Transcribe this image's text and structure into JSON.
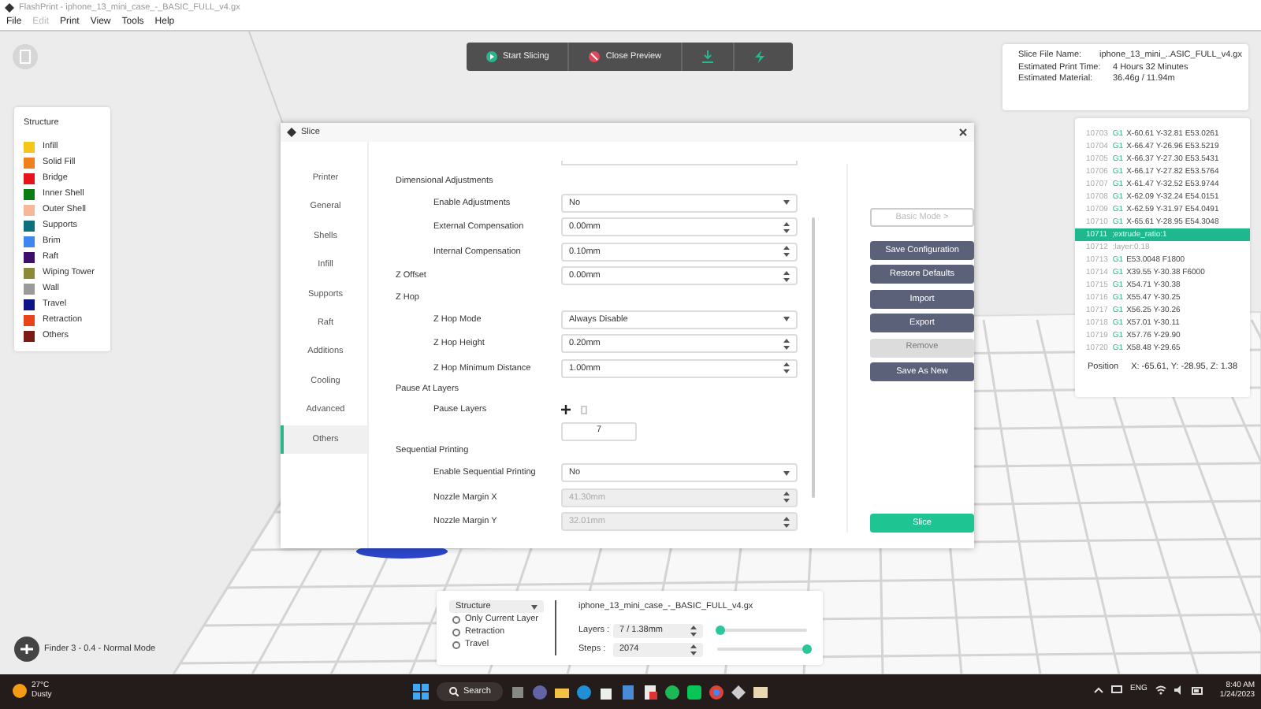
{
  "window": {
    "title": "FlashPrint - iphone_13_mini_case_-_BASIC_FULL_v4.gx"
  },
  "menu": [
    {
      "label": "File",
      "disabled": false
    },
    {
      "label": "Edit",
      "disabled": true
    },
    {
      "label": "Print",
      "disabled": false
    },
    {
      "label": "View",
      "disabled": false
    },
    {
      "label": "Tools",
      "disabled": false
    },
    {
      "label": "Help",
      "disabled": false
    }
  ],
  "toolbar": [
    {
      "kind": "start",
      "label": "Start Slicing"
    },
    {
      "kind": "close",
      "label": "Close Preview"
    },
    {
      "kind": "export"
    },
    {
      "kind": "send"
    }
  ],
  "slice_info": [
    {
      "label": "Slice File Name:",
      "value": "iphone_13_mini_..ASIC_FULL_v4.gx"
    },
    {
      "label": "Estimated Print Time:",
      "value": "4 Hours 32 Minutes"
    },
    {
      "label": "Estimated Material:",
      "value": "36.46g / 11.94m"
    }
  ],
  "gcode": {
    "lines": [
      {
        "number": "10703",
        "command": "G1",
        "args": "X-60.61 Y-32.81 E53.0261",
        "selected": false
      },
      {
        "number": "10704",
        "command": "G1",
        "args": "X-66.47 Y-26.96 E53.5219",
        "selected": false
      },
      {
        "number": "10705",
        "command": "G1",
        "args": "X-66.37 Y-27.30 E53.5431",
        "selected": false
      },
      {
        "number": "10706",
        "command": "G1",
        "args": "X-66.17 Y-27.82 E53.5764",
        "selected": false
      },
      {
        "number": "10707",
        "command": "G1",
        "args": "X-61.47 Y-32.52 E53.9744",
        "selected": false
      },
      {
        "number": "10708",
        "command": "G1",
        "args": "X-62.09 Y-32.24 E54.0151",
        "selected": false
      },
      {
        "number": "10709",
        "command": "G1",
        "args": "X-62.59 Y-31.97 E54.0491",
        "selected": false
      },
      {
        "number": "10710",
        "command": "G1",
        "args": "X-65.61 Y-28.95 E54.3048",
        "selected": false
      },
      {
        "number": "10711",
        "args": ";extrude_ratio:1",
        "selected": true
      },
      {
        "number": "10712",
        "args": ";layer:0.18",
        "selected": false
      },
      {
        "number": "10713",
        "command": "G1",
        "args": "E53.0048 F1800",
        "selected": false
      },
      {
        "number": "10714",
        "command": "G1",
        "args": "X39.55 Y-30.38 F6000",
        "selected": false
      },
      {
        "number": "10715",
        "command": "G1",
        "args": "X54.71 Y-30.38",
        "selected": false
      },
      {
        "number": "10716",
        "command": "G1",
        "args": "X55.47 Y-30.25",
        "selected": false
      },
      {
        "number": "10717",
        "command": "G1",
        "args": "X56.25 Y-30.26",
        "selected": false
      },
      {
        "number": "10718",
        "command": "G1",
        "args": "X57.01 Y-30.11",
        "selected": false
      },
      {
        "number": "10719",
        "command": "G1",
        "args": "X57.76 Y-29.90",
        "selected": false
      },
      {
        "number": "10720",
        "command": "G1",
        "args": "X58.48 Y-29.65",
        "selected": false
      }
    ],
    "position_label": "Position",
    "position_value": "X: -65.61, Y: -28.95, Z: 1.38"
  },
  "legend": {
    "title": "Structure",
    "items": [
      {
        "label": "Infill",
        "color": "#f5c518"
      },
      {
        "label": "Solid Fill",
        "color": "#f07f1e"
      },
      {
        "label": "Bridge",
        "color": "#e5141b"
      },
      {
        "label": "Inner Shell",
        "color": "#0b7d12"
      },
      {
        "label": "Outer Shell",
        "color": "#f5b999"
      },
      {
        "label": "Supports",
        "color": "#0c6f7c"
      },
      {
        "label": "Brim",
        "color": "#3f86f0"
      },
      {
        "label": "Raft",
        "color": "#3d0f6b"
      },
      {
        "label": "Wiping Tower",
        "color": "#8a8a3a"
      },
      {
        "label": "Wall",
        "color": "#9a9a9a"
      },
      {
        "label": "Travel",
        "color": "#0d1487"
      },
      {
        "label": "Retraction",
        "color": "#e8431a"
      },
      {
        "label": "Others",
        "color": "#7a1c14"
      }
    ]
  },
  "dialog": {
    "title": "Slice",
    "nav": [
      {
        "label": "Printer",
        "selected": false
      },
      {
        "label": "General",
        "selected": false
      },
      {
        "label": "Shells",
        "selected": false
      },
      {
        "label": "Infill",
        "selected": false
      },
      {
        "label": "Supports",
        "selected": false
      },
      {
        "label": "Raft",
        "selected": false
      },
      {
        "label": "Additions",
        "selected": false
      },
      {
        "label": "Cooling",
        "selected": false
      },
      {
        "label": "Advanced",
        "selected": false
      },
      {
        "label": "Others",
        "selected": true
      }
    ],
    "settings": [
      {
        "kind": "section",
        "label": "Dimensional Adjustments"
      },
      {
        "kind": "select",
        "label": "Enable Adjustments",
        "value": "No",
        "indented": true,
        "disabled": false
      },
      {
        "kind": "spin",
        "label": "External Compensation",
        "value": "0.00mm",
        "indented": true,
        "disabled": false
      },
      {
        "kind": "spin",
        "label": "Internal Compensation",
        "value": "0.10mm",
        "indented": true,
        "disabled": false
      },
      {
        "kind": "spin",
        "label": "Z Offset",
        "value": "0.00mm",
        "indented": false,
        "disabled": false
      },
      {
        "kind": "section",
        "label": "Z Hop"
      },
      {
        "kind": "select",
        "label": "Z Hop Mode",
        "value": "Always Disable",
        "indented": true,
        "disabled": false
      },
      {
        "kind": "spin",
        "label": "Z Hop Height",
        "value": "0.20mm",
        "indented": true,
        "disabled": false
      },
      {
        "kind": "spin",
        "label": "Z Hop Minimum Distance",
        "value": "1.00mm",
        "indented": true,
        "disabled": false
      },
      {
        "kind": "section",
        "label": "Pause At Layers"
      },
      {
        "kind": "pause",
        "label": "Pause Layers",
        "values": [
          "7"
        ]
      },
      {
        "kind": "section",
        "label": "Sequential Printing"
      },
      {
        "kind": "select",
        "label": "Enable Sequential Printing",
        "value": "No",
        "indented": true,
        "disabled": false
      },
      {
        "kind": "spin",
        "label": "Nozzle Margin X",
        "value": "41.30mm",
        "indented": true,
        "disabled": true
      },
      {
        "kind": "spin",
        "label": "Nozzle Margin Y",
        "value": "32.01mm",
        "indented": true,
        "disabled": true
      }
    ],
    "buttons": [
      {
        "kind": "outline",
        "label": "Basic Mode >",
        "disabled": true
      },
      {
        "kind": "solid",
        "label": "Save Configuration",
        "disabled": false
      },
      {
        "kind": "solid",
        "label": "Restore Defaults",
        "disabled": false
      },
      {
        "kind": "solid",
        "label": "Import",
        "disabled": false
      },
      {
        "kind": "solid",
        "label": "Export",
        "disabled": false
      },
      {
        "kind": "solid",
        "label": "Remove",
        "disabled": true
      },
      {
        "kind": "solid",
        "label": "Save As New",
        "disabled": false
      }
    ],
    "slice_button": "Slice"
  },
  "preview": {
    "mode": "Structure",
    "options": [
      {
        "label": "Only Current Layer",
        "checked": false
      },
      {
        "label": "Retraction",
        "checked": false
      },
      {
        "label": "Travel",
        "checked": false
      }
    ],
    "file": "iphone_13_mini_case_-_BASIC_FULL_v4.gx",
    "sliders": [
      {
        "label": "Layers :",
        "value": "7 / 1.38mm",
        "level": 0.04
      },
      {
        "label": "Steps :",
        "value": "2074",
        "level": 1
      }
    ]
  },
  "status": "Finder 3 - 0.4 - Normal Mode",
  "taskbar": {
    "temperature": "27°C",
    "weather": "Dusty",
    "search": "Search",
    "language": "ENG",
    "time": "8:40 AM",
    "date": "1/24/2023"
  }
}
